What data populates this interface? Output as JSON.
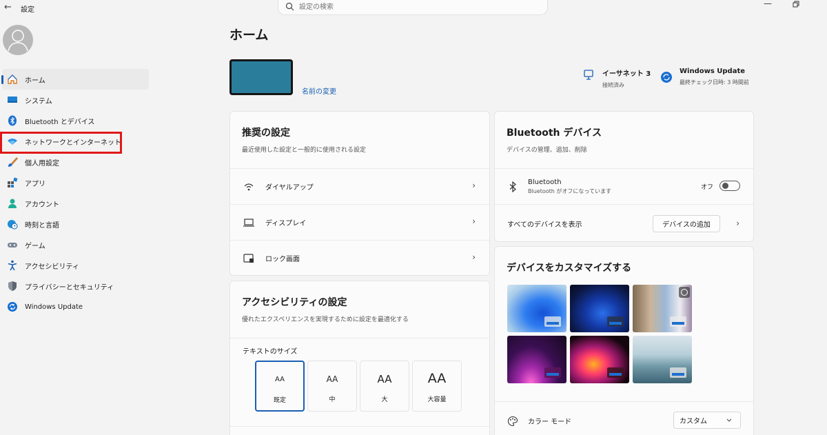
{
  "window": {
    "title": "設定"
  },
  "search": {
    "placeholder": "設定の検索"
  },
  "sidebar": {
    "items": [
      {
        "label": "ホーム",
        "icon": "home-icon"
      },
      {
        "label": "システム",
        "icon": "display-icon"
      },
      {
        "label": "Bluetooth とデバイス",
        "icon": "bluetooth-icon"
      },
      {
        "label": "ネットワークとインターネット",
        "icon": "wifi-icon"
      },
      {
        "label": "個人用設定",
        "icon": "brush-icon"
      },
      {
        "label": "アプリ",
        "icon": "apps-icon"
      },
      {
        "label": "アカウント",
        "icon": "person-icon"
      },
      {
        "label": "時刻と言語",
        "icon": "globe-clock-icon"
      },
      {
        "label": "ゲーム",
        "icon": "gamepad-icon"
      },
      {
        "label": "アクセシビリティ",
        "icon": "accessibility-icon"
      },
      {
        "label": "プライバシーとセキュリティ",
        "icon": "shield-icon"
      },
      {
        "label": "Windows Update",
        "icon": "update-icon"
      }
    ]
  },
  "main": {
    "title": "ホーム",
    "rename": "名前の変更",
    "status": {
      "network": {
        "title": "イーサネット 3",
        "sub": "接続済み"
      },
      "update": {
        "title": "Windows Update",
        "sub": "最終チェック日時: 3 時間前"
      }
    },
    "recommended": {
      "title": "推奨の設定",
      "sub": "最近使用した設定と一般的に使用される設定",
      "rows": [
        {
          "label": "ダイヤルアップ",
          "icon": "dialup-icon"
        },
        {
          "label": "ディスプレイ",
          "icon": "laptop-icon"
        },
        {
          "label": "ロック画面",
          "icon": "lock-screen-icon"
        }
      ]
    },
    "accessibility": {
      "title": "アクセシビリティの設定",
      "sub": "優れたエクスペリエンスを実現するために設定を最適化する",
      "text_size_label": "テキストのサイズ",
      "sizes": [
        {
          "glyph": "AA",
          "label": "既定"
        },
        {
          "glyph": "AA",
          "label": "中"
        },
        {
          "glyph": "AA",
          "label": "大"
        },
        {
          "glyph": "AA",
          "label": "大容量"
        }
      ]
    },
    "bluetooth": {
      "title": "Bluetooth デバイス",
      "sub": "デバイスの管理、追加、削除",
      "bt_title": "Bluetooth",
      "bt_sub": "Bluetooth がオフになっています",
      "toggle_state": "オフ",
      "show_all": "すべてのデバイスを表示",
      "add_device": "デバイスの追加"
    },
    "customize": {
      "title": "デバイスをカスタマイズする",
      "color_mode_label": "カラー モード",
      "color_mode_value": "カスタム"
    }
  },
  "colors": {
    "accent": "#1a5fb4",
    "highlight": "#e01818",
    "device": "#2b7e9b"
  }
}
